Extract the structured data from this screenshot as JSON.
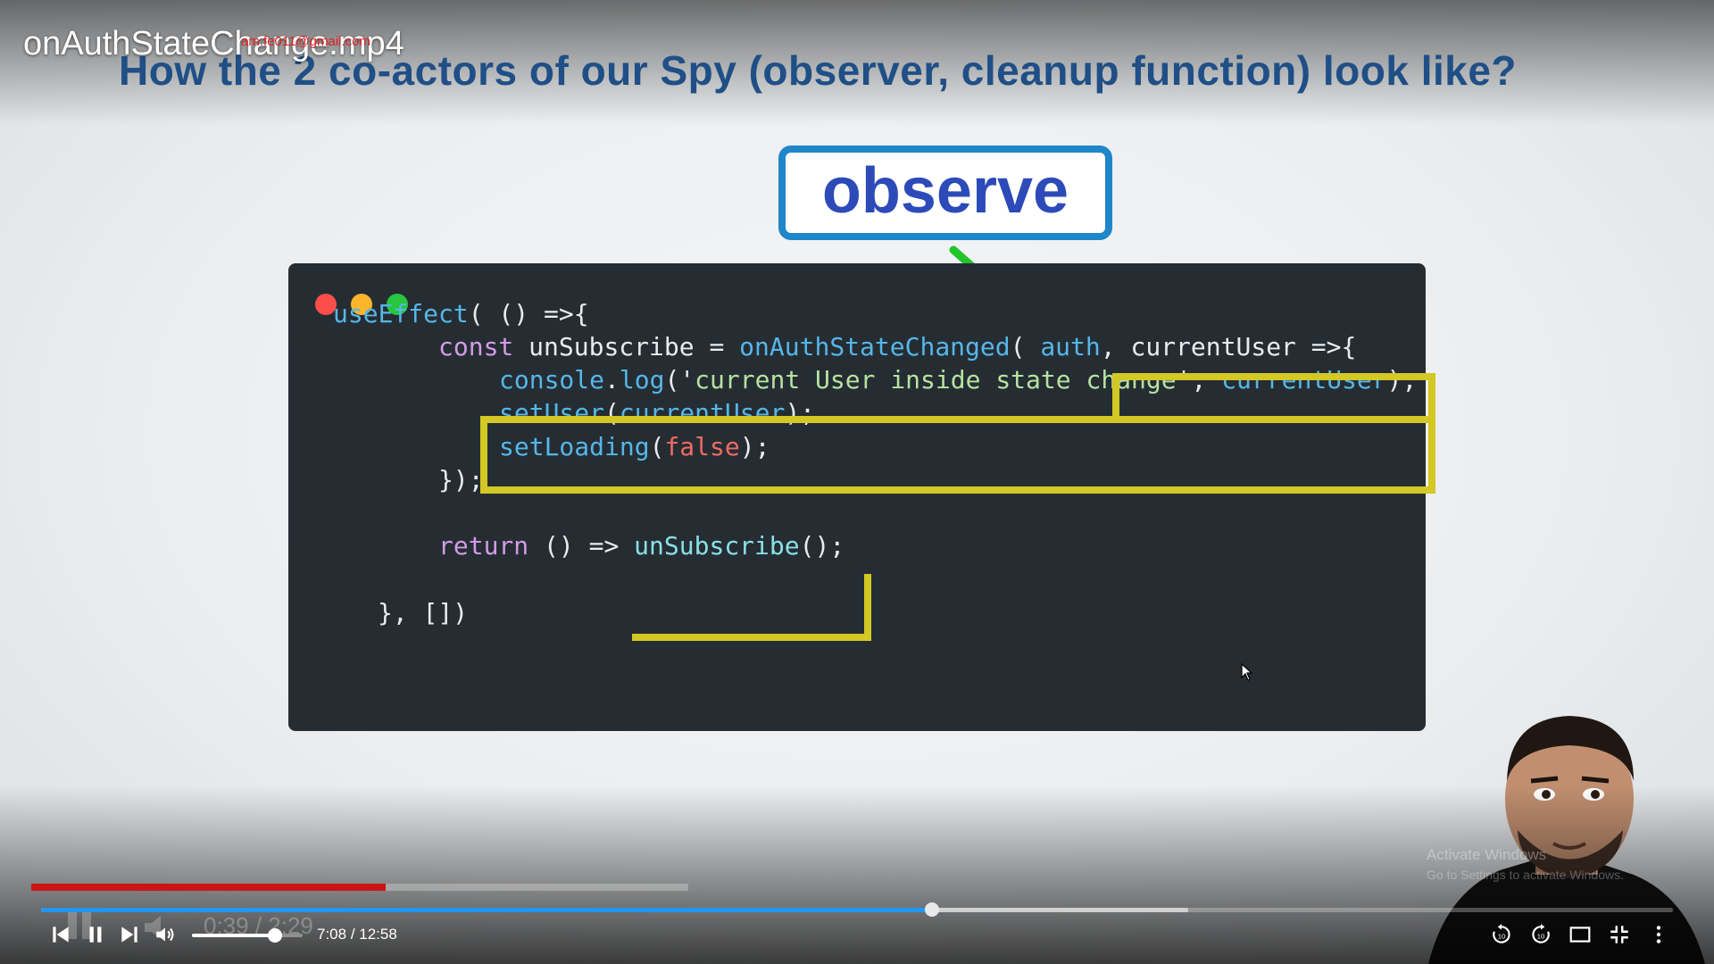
{
  "player": {
    "file_title": "onAuthStateChange.mp4",
    "watermark_email": "am.fe011@gmail.com",
    "current_time": "7:08",
    "separator": " / ",
    "duration": "12:58",
    "progress_fraction": 0.546,
    "buffered_fraction": 0.703,
    "volume_fraction": 0.75,
    "accent_color": "#2196f3",
    "controls": {
      "previous": "skip-previous-icon",
      "pause": "pause-icon",
      "next": "skip-next-icon",
      "volume": "volume-icon",
      "replay10": "replay-10-icon",
      "forward10": "forward-10-icon",
      "aspect": "aspect-ratio-icon",
      "fullscreen": "exit-fullscreen-icon",
      "more": "more-vert-icon"
    }
  },
  "video_frame": {
    "slide_title": "How the 2 co-actors of our Spy (observer, cleanup function) look like?",
    "callout_label": "observe",
    "code_lines": [
      {
        "parts": [
          {
            "t": "useEffect",
            "c": "fn"
          },
          {
            "t": "( () =>{",
            "c": "punc"
          }
        ]
      },
      {
        "parts": [
          {
            "t": "const ",
            "c": "kw"
          },
          {
            "t": "unSubscribe = ",
            "c": "punc"
          },
          {
            "t": "onAuthStateChanged",
            "c": "fn"
          },
          {
            "t": "( ",
            "c": "punc"
          },
          {
            "t": "auth",
            "c": "fn"
          },
          {
            "t": ", currentUser =>{",
            "c": "punc"
          }
        ]
      },
      {
        "parts": [
          {
            "t": "console",
            "c": "fn"
          },
          {
            "t": ".",
            "c": "punc"
          },
          {
            "t": "log",
            "c": "fn"
          },
          {
            "t": "('",
            "c": "punc"
          },
          {
            "t": "current User inside state change",
            "c": "str"
          },
          {
            "t": "', ",
            "c": "punc"
          },
          {
            "t": "currentUser",
            "c": "fn"
          },
          {
            "t": ");",
            "c": "punc"
          }
        ]
      },
      {
        "parts": [
          {
            "t": "setUser",
            "c": "fn"
          },
          {
            "t": "(",
            "c": "punc"
          },
          {
            "t": "currentUser",
            "c": "fn"
          },
          {
            "t": ");",
            "c": "punc"
          }
        ]
      },
      {
        "parts": [
          {
            "t": "setLoading",
            "c": "fn"
          },
          {
            "t": "(",
            "c": "punc"
          },
          {
            "t": "false",
            "c": "bool"
          },
          {
            "t": ");",
            "c": "punc"
          }
        ]
      },
      {
        "parts": [
          {
            "t": "});",
            "c": "punc"
          }
        ]
      },
      {
        "parts": [
          {
            "t": "return ",
            "c": "kw"
          },
          {
            "t": "() => ",
            "c": "punc"
          },
          {
            "t": "unSubscribe",
            "c": "fn2"
          },
          {
            "t": "();",
            "c": "punc"
          }
        ]
      },
      {
        "parts": [
          {
            "t": "}, [])",
            "c": "punc"
          }
        ]
      }
    ],
    "inner_player": {
      "ghost_time": "0:39 / 2:29",
      "progress_fraction": 0.54,
      "progress_color": "#cc1414"
    },
    "os_overlay": {
      "title": "Activate Windows",
      "subtitle": "Go to Settings to activate Windows."
    }
  }
}
